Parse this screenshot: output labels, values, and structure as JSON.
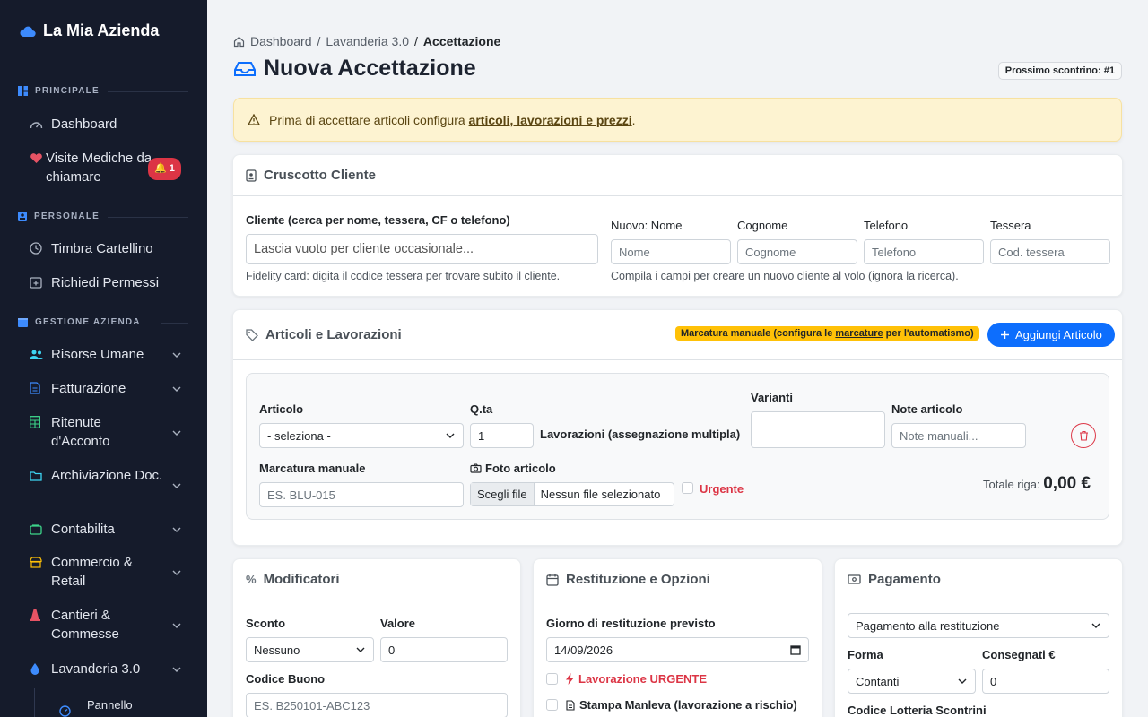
{
  "sidebar": {
    "brand": "La Mia Azienda",
    "sections": {
      "principale": "PRINCIPALE",
      "personale": "PERSONALE",
      "gestione": "GESTIONE AZIENDA"
    },
    "items": {
      "dashboard": "Dashboard",
      "visite": "Visite Mediche da chiamare",
      "visite_badge": "1",
      "timbra": "Timbra Cartellino",
      "permessi": "Richiedi Permessi",
      "risorse": "Risorse Umane",
      "fatturazione": "Fatturazione",
      "ritenute": "Ritenute d'Acconto",
      "archiviazione": "Archiviazione Doc.",
      "contabilita": "Contabilita",
      "commercio": "Commercio & Retail",
      "cantieri": "Cantieri & Commesse",
      "lavanderia": "Lavanderia 3.0",
      "pannello": "Pannello"
    }
  },
  "breadcrumb": {
    "home": "Dashboard",
    "section": "Lavanderia 3.0",
    "current": "Accettazione"
  },
  "page_title": "Nuova Accettazione",
  "receipt_badge": "Prossimo scontrino: #1",
  "alert": {
    "text": "Prima di accettare articoli configura ",
    "link": "articoli, lavorazioni e prezzi",
    "tail": "."
  },
  "cliente": {
    "title": "Cruscotto Cliente",
    "search_label": "Cliente (cerca per nome, tessera, CF o telefono)",
    "search_placeholder": "Lascia vuoto per cliente occasionale...",
    "search_help": "Fidelity card: digita il codice tessera per trovare subito il cliente.",
    "nome_label": "Nuovo: Nome",
    "nome_ph": "Nome",
    "cognome_label": "Cognome",
    "cognome_ph": "Cognome",
    "telefono_label": "Telefono",
    "telefono_ph": "Telefono",
    "tessera_label": "Tessera",
    "tessera_ph": "Cod. tessera",
    "new_help": "Compila i campi per creare un nuovo cliente al volo (ignora la ricerca)."
  },
  "articoli": {
    "title": "Articoli e Lavorazioni",
    "badge_a": "Marcatura manuale (configura le ",
    "badge_link": "marcature",
    "badge_b": " per l'automatismo)",
    "add_button": "Aggiungi Articolo",
    "articolo_label": "Articolo",
    "articolo_value": "- seleziona -",
    "qta_label": "Q.ta",
    "qta_value": "1",
    "lavorazioni_label": "Lavorazioni (assegnazione multipla)",
    "varianti_label": "Varianti",
    "note_label": "Note articolo",
    "note_ph": "Note manuali...",
    "marcatura_label": "Marcatura manuale",
    "marcatura_ph": "ES. BLU-015",
    "foto_label": "Foto articolo",
    "file_button": "Scegli file",
    "file_text": "Nessun file selezionato",
    "urgente_label": "Urgente",
    "totale_label": "Totale riga:",
    "totale_value": "0,00 €"
  },
  "modificatori": {
    "title": "Modificatori",
    "sconto_label": "Sconto",
    "sconto_value": "Nessuno",
    "valore_label": "Valore",
    "valore_value": "0",
    "buono_label": "Codice Buono",
    "buono_ph": "ES. B250101-ABC123"
  },
  "restituzione": {
    "title": "Restituzione e Opzioni",
    "giorno_label": "Giorno di restituzione previsto",
    "giorno_value": "14/09/2026",
    "urgente_label": "Lavorazione URGENTE",
    "manleva_label": "Stampa Manleva (lavorazione a rischio)"
  },
  "pagamento": {
    "title": "Pagamento",
    "modo_value": "Pagamento alla restituzione",
    "forma_label": "Forma",
    "forma_value": "Contanti",
    "consegnati_label": "Consegnati €",
    "consegnati_value": "0",
    "lotteria_label": "Codice Lotteria Scontrini"
  },
  "colors": {
    "sidebar_bg": "#151b2b",
    "primary": "#0d6efd",
    "danger": "#dc3545",
    "warning": "#ffc107"
  }
}
